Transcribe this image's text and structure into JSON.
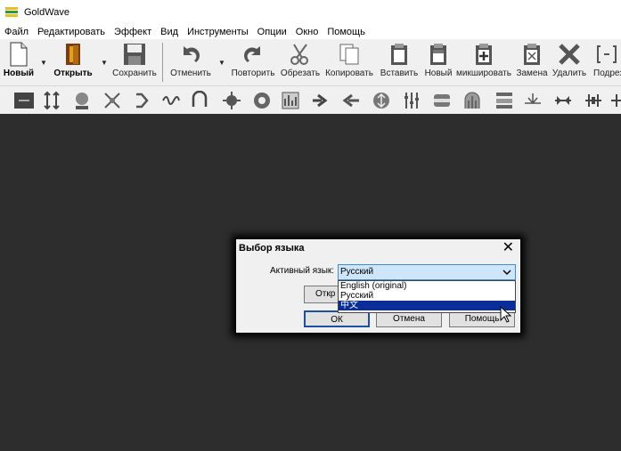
{
  "app": {
    "title": "GoldWave"
  },
  "menu": [
    "Файл",
    "Редактировать",
    "Эффект",
    "Вид",
    "Инструменты",
    "Опции",
    "Окно",
    "Помощь"
  ],
  "toolbar": {
    "new": "Новый",
    "open": "Открыть",
    "save": "Сохранить",
    "undo": "Отменить",
    "redo": "Повторить",
    "trim": "Обрезать",
    "copy": "Копировать",
    "paste": "Вставить",
    "paste_new": "Новый",
    "mix": "микшировать",
    "replace": "Замена",
    "delete": "Удалить",
    "more": "Подрез"
  },
  "dialog": {
    "title": "Выбор языка",
    "close_label": "✕",
    "active_label": "Активный язык:",
    "selected": "Русский",
    "options": [
      "English (original)",
      "Русский",
      "中文"
    ],
    "hidden_button": "Откр",
    "ok": "ОК",
    "cancel": "Отмена",
    "help": "Помощь"
  }
}
